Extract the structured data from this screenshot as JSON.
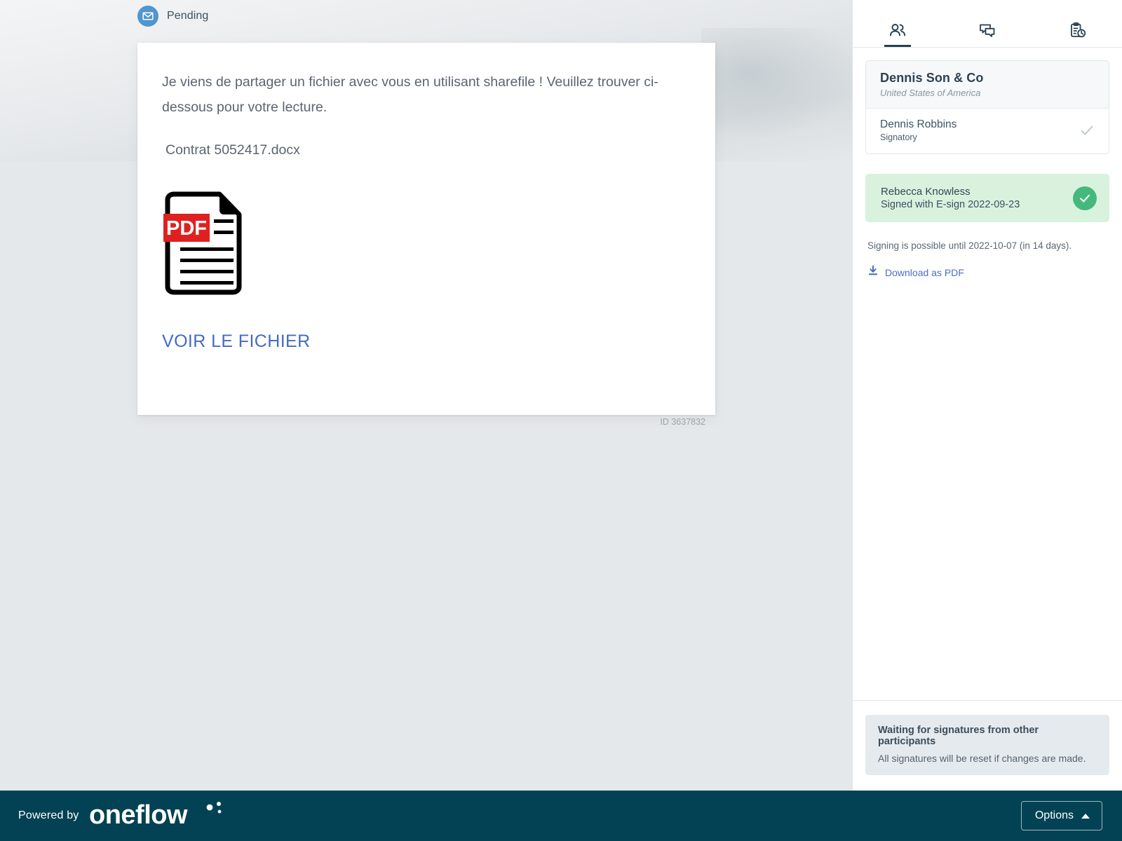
{
  "status": {
    "icon": "envelope-icon",
    "label": "Pending"
  },
  "document": {
    "paragraph": "Je viens de partager un fichier avec vous en utilisant sharefile ! Veuillez trouver ci-dessous pour votre lecture.",
    "filename": "Contrat 5052417.docx",
    "attachment_icon": "pdf-file-icon",
    "attachment_badge": "PDF",
    "view_link": "VOIR LE FICHIER",
    "id_label": "ID 3637832"
  },
  "sidebar": {
    "tabs": [
      {
        "icon": "participants-icon",
        "name": "participants",
        "active": true
      },
      {
        "icon": "comments-icon",
        "name": "comments",
        "active": false
      },
      {
        "icon": "audit-trail-icon",
        "name": "audit-trail",
        "active": false
      }
    ],
    "party": {
      "company": "Dennis Son & Co",
      "country": "United States of America",
      "person": {
        "name": "Dennis Robbins",
        "role": "Signatory",
        "state_icon": "check-icon"
      }
    },
    "signed": {
      "name": "Rebecca Knowless",
      "detail": "Signed with E-sign 2022-09-23",
      "state_icon": "check-circle-icon"
    },
    "deadline": "Signing is possible until 2022-10-07 (in 14 days).",
    "download": {
      "icon": "download-icon",
      "label": "Download as PDF"
    },
    "waiting": {
      "title": "Waiting for signatures from other participants",
      "subtitle": "All signatures will be reset if changes are made."
    }
  },
  "footer": {
    "powered_by": "Powered by",
    "brand": "oneflow",
    "options_label": "Options",
    "options_caret": "caret-up-icon"
  },
  "colors": {
    "accent_blue": "#456ac4",
    "status_blue": "#5196ce",
    "signed_green": "#45b97c",
    "signed_green_bg": "#d8f2dd",
    "footer_dark": "#024254",
    "page_bg": "#e5e8ea",
    "pdf_red": "#e02020"
  }
}
